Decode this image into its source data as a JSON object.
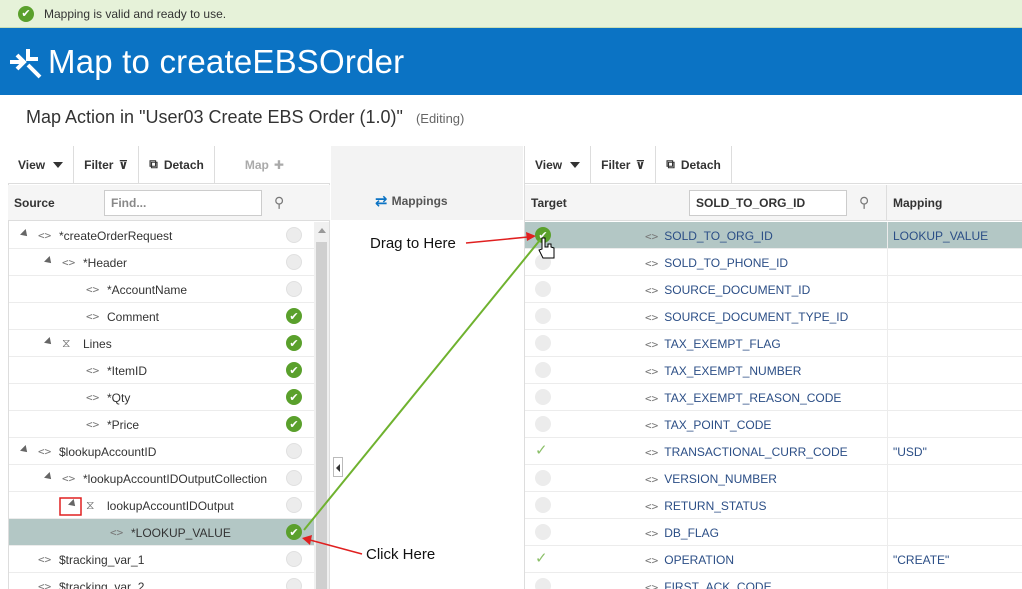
{
  "status": {
    "message": "Mapping is valid and ready to use."
  },
  "header": {
    "title": "Map to createEBSOrder"
  },
  "subheader": {
    "title": "Map Action in \"User03 Create EBS Order (1.0)\"",
    "mode": "(Editing)"
  },
  "left_toolbar": {
    "view": "View",
    "filter": "Filter",
    "detach": "Detach",
    "map": "Map"
  },
  "right_toolbar": {
    "view": "View",
    "filter": "Filter",
    "detach": "Detach"
  },
  "source": {
    "title": "Source",
    "search_placeholder": "Find...",
    "rows": [
      {
        "label": "*createOrderRequest",
        "mapped": false
      },
      {
        "label": "*Header",
        "mapped": false
      },
      {
        "label": "*AccountName",
        "mapped": false
      },
      {
        "label": "Comment",
        "mapped": true
      },
      {
        "label": "Lines",
        "mapped": true
      },
      {
        "label": "*ItemID",
        "mapped": true
      },
      {
        "label": "*Qty",
        "mapped": true
      },
      {
        "label": "*Price",
        "mapped": true
      },
      {
        "label": "$lookupAccountID",
        "mapped": false
      },
      {
        "label": "*lookupAccountIDOutputCollection",
        "mapped": false
      },
      {
        "label": "lookupAccountIDOutput",
        "mapped": false
      },
      {
        "label": "*LOOKUP_VALUE",
        "mapped": true
      },
      {
        "label": "$tracking_var_1",
        "mapped": false
      },
      {
        "label": "$tracking_var_2",
        "mapped": false
      }
    ]
  },
  "middle": {
    "title": "Mappings"
  },
  "target": {
    "title": "Target",
    "search_value": "SOLD_TO_ORG_ID",
    "mapping_header": "Mapping",
    "rows": [
      {
        "label": "SOLD_TO_ORG_ID",
        "mapping": "LOOKUP_VALUE",
        "status": "ok"
      },
      {
        "label": "SOLD_TO_PHONE_ID",
        "mapping": "",
        "status": "none"
      },
      {
        "label": "SOURCE_DOCUMENT_ID",
        "mapping": "",
        "status": "none"
      },
      {
        "label": "SOURCE_DOCUMENT_TYPE_ID",
        "mapping": "",
        "status": "none"
      },
      {
        "label": "TAX_EXEMPT_FLAG",
        "mapping": "",
        "status": "none"
      },
      {
        "label": "TAX_EXEMPT_NUMBER",
        "mapping": "",
        "status": "none"
      },
      {
        "label": "TAX_EXEMPT_REASON_CODE",
        "mapping": "",
        "status": "none"
      },
      {
        "label": "TAX_POINT_CODE",
        "mapping": "",
        "status": "none"
      },
      {
        "label": "TRANSACTIONAL_CURR_CODE",
        "mapping": "\"USD\"",
        "status": "tick"
      },
      {
        "label": "VERSION_NUMBER",
        "mapping": "",
        "status": "none"
      },
      {
        "label": "RETURN_STATUS",
        "mapping": "",
        "status": "none"
      },
      {
        "label": "DB_FLAG",
        "mapping": "",
        "status": "none"
      },
      {
        "label": "OPERATION",
        "mapping": "\"CREATE\"",
        "status": "tick"
      },
      {
        "label": "FIRST_ACK_CODE",
        "mapping": "",
        "status": "none"
      }
    ]
  },
  "annotations": {
    "drag": "Drag to Here",
    "click": "Click Here"
  },
  "colors": {
    "header_bg": "#0b73c4",
    "status_bg": "#e6f2d9",
    "ok_green": "#5aa02c",
    "selected_row": "#b3c7c5",
    "annotation_arrow": "#e02020",
    "link_line": "#6fb22f"
  }
}
